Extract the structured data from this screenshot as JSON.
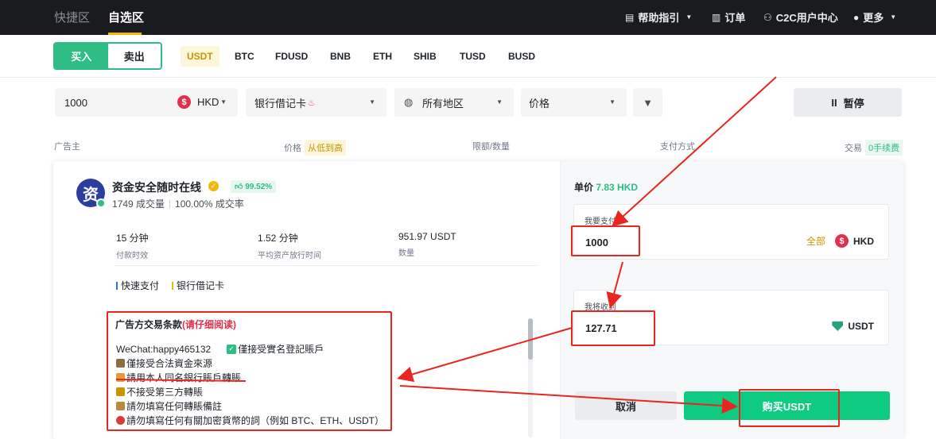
{
  "nav": {
    "tab_quick": "快捷区",
    "tab_selected": "自选区",
    "links": [
      {
        "icon": "help-icon",
        "label": "帮助指引",
        "caret": "▼"
      },
      {
        "icon": "order-icon",
        "label": "订单"
      },
      {
        "icon": "c2c-user-icon",
        "label": "C2C用户中心"
      },
      {
        "icon": "more-icon",
        "label": "更多",
        "caret": "▼"
      }
    ]
  },
  "trade": {
    "buy": "买入",
    "sell": "卖出",
    "coins": [
      "USDT",
      "BTC",
      "FDUSD",
      "BNB",
      "ETH",
      "SHIB",
      "TUSD",
      "BUSD"
    ],
    "active_coin": "USDT"
  },
  "filters": {
    "amount": "1000",
    "currency": "HKD",
    "payment": "银行借记卡",
    "region": "所有地区",
    "sort": "价格",
    "pause": "暂停"
  },
  "table_header": {
    "advertiser": "广告主",
    "price": "价格",
    "price_sort": "从低到高",
    "limit": "限额/数量",
    "payment": "支付方式",
    "trade": "交易",
    "fee": "0手续费"
  },
  "ad": {
    "avatar_char": "资",
    "merchant": "资金安全随时在线",
    "rating": "99.52%",
    "orders": "1749 成交量",
    "completion": "100.00% 成交率",
    "pay_time_value": "15 分钟",
    "pay_time_label": "付款时效",
    "release_value": "1.52 分钟",
    "release_label": "平均资产放行时间",
    "qty_value": "951.97 USDT",
    "qty_label": "数量",
    "pay_methods": [
      "快速支付",
      "银行借记卡"
    ],
    "terms_title": "广告方交易条款",
    "terms_title_note": "(请仔细阅读)",
    "terms": [
      {
        "a": "WeChat:happy465132",
        "b": "僅接受實名登記賬戶"
      },
      {
        "a": "僅接受合法資金來源"
      },
      {
        "a": "請用本人同名銀行賬戶轉賬"
      },
      {
        "a": "不接受第三方轉賬"
      },
      {
        "a": "請勿填寫任何轉賬備註"
      },
      {
        "a": "請勿填寫任何有關加密貨幣的詞（例如 BTC、ETH、USDT）"
      }
    ]
  },
  "order_panel": {
    "unit_label": "单价",
    "unit_price": "7.83 HKD",
    "pay_label": "我要支付",
    "pay_amount": "1000",
    "all": "全部",
    "pay_currency": "HKD",
    "receive_label": "我将收到",
    "receive_amount": "127.71",
    "receive_currency": "USDT",
    "cancel": "取消",
    "buy": "购买USDT"
  },
  "colors": {
    "accent_green": "#0ecb81",
    "brand_yellow": "#f0b90b",
    "annotation_red": "#e8261f"
  }
}
